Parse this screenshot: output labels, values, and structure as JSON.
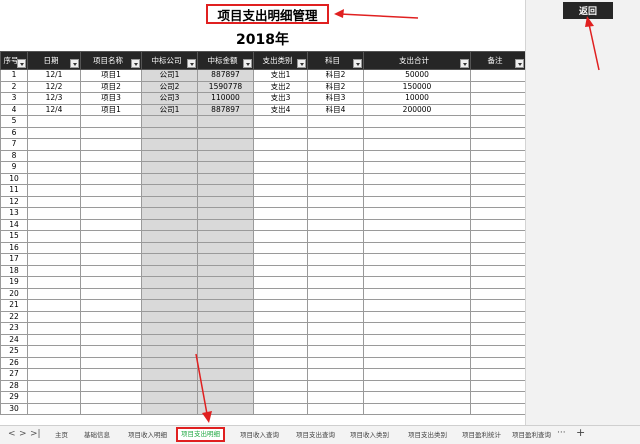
{
  "title": "项目支出明细管理",
  "year": "2018年",
  "back_label": "返回",
  "columns": [
    "序号",
    "日期",
    "项目名称",
    "中标公司",
    "中标金额",
    "支出类别",
    "科目",
    "支出合计",
    "备注"
  ],
  "rows": [
    [
      "1",
      "12/1",
      "项目1",
      "公司1",
      "887897",
      "支出1",
      "科目2",
      "50000",
      ""
    ],
    [
      "2",
      "12/2",
      "项目2",
      "公司2",
      "1590778",
      "支出2",
      "科目2",
      "150000",
      ""
    ],
    [
      "3",
      "12/3",
      "项目3",
      "公司3",
      "110000",
      "支出3",
      "科目3",
      "10000",
      ""
    ],
    [
      "4",
      "12/4",
      "项目1",
      "公司1",
      "887897",
      "支出4",
      "科目4",
      "200000",
      ""
    ],
    [
      "5"
    ],
    [
      "6"
    ],
    [
      "7"
    ],
    [
      "8"
    ],
    [
      "9"
    ],
    [
      "10"
    ],
    [
      "11"
    ],
    [
      "12"
    ],
    [
      "13"
    ],
    [
      "14"
    ],
    [
      "15"
    ],
    [
      "16"
    ],
    [
      "17"
    ],
    [
      "18"
    ],
    [
      "19"
    ],
    [
      "20"
    ],
    [
      "21"
    ],
    [
      "22"
    ],
    [
      "23"
    ],
    [
      "24"
    ],
    [
      "25"
    ],
    [
      "26"
    ],
    [
      "27"
    ],
    [
      "28"
    ],
    [
      "29"
    ],
    [
      "30"
    ]
  ],
  "tabs": [
    "主页",
    "基础信息",
    "项目收入明细",
    "项目支出明细",
    "项目收入查询",
    "项目支出查询",
    "项目收入类别",
    "项目支出类别",
    "项目盈利统计",
    "项目盈利查询"
  ],
  "active_tab": "项目支出明细",
  "tab_nav": {
    "prev": "<",
    "next": ">",
    "last": ">|",
    "more": "···",
    "add": "+"
  },
  "colors": {
    "header_bg": "#262626",
    "shaded_col": "#d9d9d9",
    "annotation": "#e02020",
    "active_tab_text": "#22aa44"
  }
}
